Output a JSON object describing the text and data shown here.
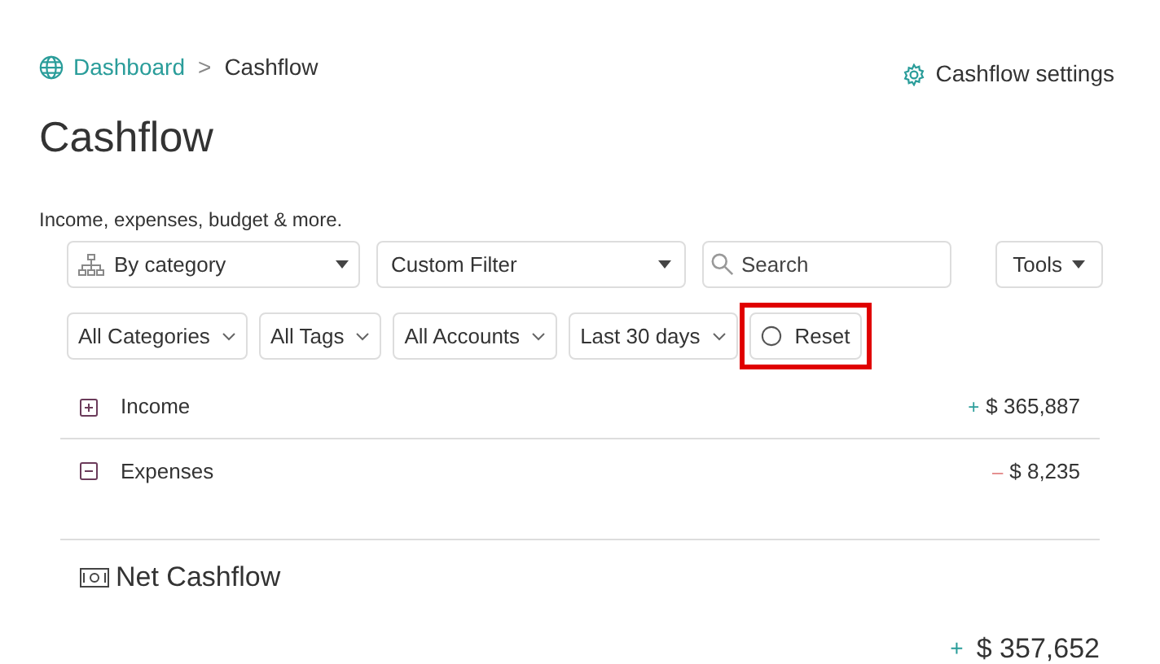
{
  "breadcrumb": [
    {
      "label": "Dashboard",
      "kind": "link"
    },
    {
      "label": ">",
      "kind": "separator"
    },
    {
      "label": "Cashflow",
      "kind": "current"
    }
  ],
  "settings_link": "Cashflow settings",
  "title": "Cashflow",
  "description": "Income, expenses, budget & more.",
  "toolbar": {
    "grouping": "By category",
    "filter": "Custom Filter",
    "search": {
      "placeholder": "Search"
    },
    "tools": "Tools"
  },
  "filters": [
    {
      "label": "All Categories"
    },
    {
      "label": "All Tags"
    },
    {
      "label": "All Accounts"
    },
    {
      "label": "Last 30 days"
    }
  ],
  "reset": {
    "label": "Reset",
    "highlighted": true
  },
  "rows": [
    {
      "label": "Income",
      "expanded": false,
      "sign": "+",
      "color": "#2a9d9a",
      "amount": "$ 365,887"
    },
    {
      "label": "Expenses",
      "expanded": true,
      "sign": "–",
      "color": "#e07a7a",
      "amount": "$ 8,235"
    }
  ],
  "net": {
    "label": "Net Cashflow",
    "sign": "+",
    "color": "#2a9d9a",
    "amount": "$ 357,652"
  }
}
